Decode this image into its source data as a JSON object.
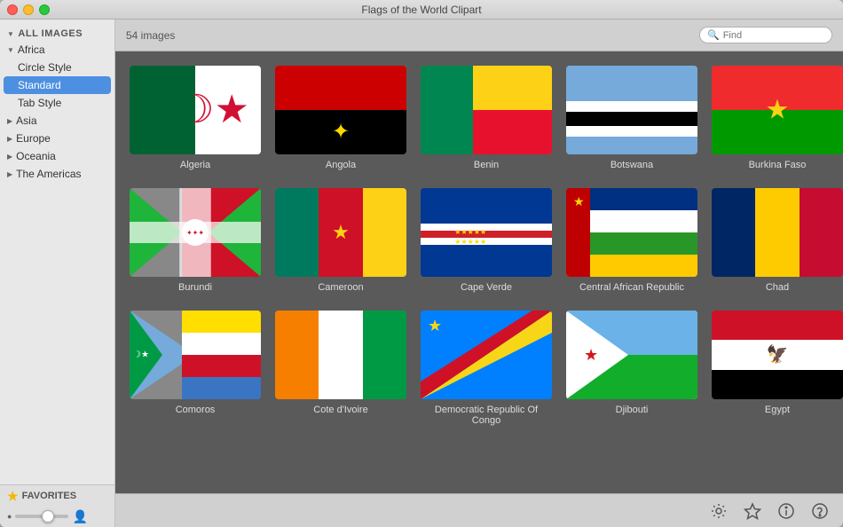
{
  "window": {
    "title": "Flags of the World Clipart",
    "buttons": [
      "close",
      "minimize",
      "maximize"
    ]
  },
  "toolbar": {
    "image_count": "54 images",
    "search_placeholder": "Find"
  },
  "sidebar": {
    "all_images_label": "ALL IMAGES",
    "favorites_label": "FAVORITES",
    "groups": [
      {
        "id": "africa",
        "label": "Africa",
        "expanded": true,
        "children": [
          {
            "id": "circle-style",
            "label": "Circle Style",
            "active": false
          },
          {
            "id": "standard",
            "label": "Standard",
            "active": true
          },
          {
            "id": "tab-style",
            "label": "Tab Style",
            "active": false
          }
        ]
      },
      {
        "id": "asia",
        "label": "Asia",
        "expanded": false,
        "children": []
      },
      {
        "id": "europe",
        "label": "Europe",
        "expanded": false,
        "children": []
      },
      {
        "id": "oceania",
        "label": "Oceania",
        "expanded": false,
        "children": []
      },
      {
        "id": "the-americas",
        "label": "The Americas",
        "expanded": false,
        "children": []
      }
    ]
  },
  "flags": [
    {
      "id": "algeria",
      "name": "Algeria"
    },
    {
      "id": "angola",
      "name": "Angola"
    },
    {
      "id": "benin",
      "name": "Benin"
    },
    {
      "id": "botswana",
      "name": "Botswana"
    },
    {
      "id": "burkina-faso",
      "name": "Burkina Faso"
    },
    {
      "id": "burundi",
      "name": "Burundi"
    },
    {
      "id": "cameroon",
      "name": "Cameroon"
    },
    {
      "id": "cape-verde",
      "name": "Cape Verde"
    },
    {
      "id": "central-african-republic",
      "name": "Central African Republic"
    },
    {
      "id": "chad",
      "name": "Chad"
    },
    {
      "id": "comoros",
      "name": "Comoros"
    },
    {
      "id": "cote-divoire",
      "name": "Cote d'Ivoire"
    },
    {
      "id": "drc",
      "name": "Democratic Republic Of Congo"
    },
    {
      "id": "djibouti",
      "name": "Djibouti"
    },
    {
      "id": "egypt",
      "name": "Egypt"
    }
  ],
  "bottom_icons": [
    "gear",
    "star",
    "info",
    "question"
  ]
}
